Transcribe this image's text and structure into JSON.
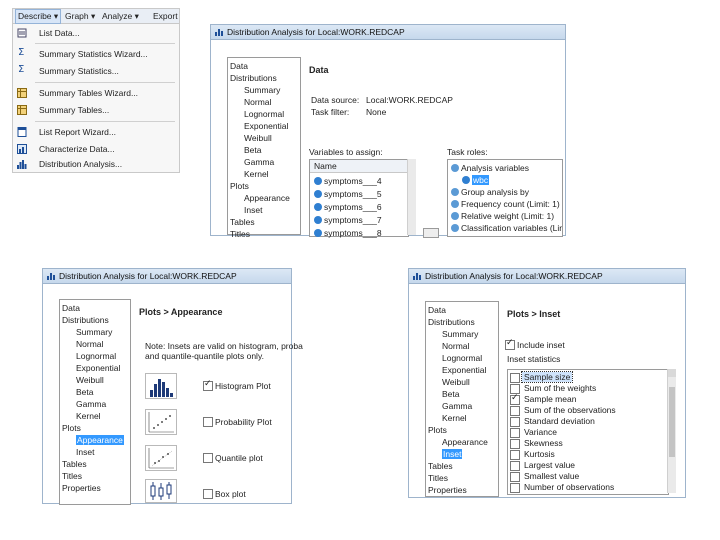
{
  "menu": {
    "bar": [
      "Describe",
      "Graph",
      "Analyze",
      "Export"
    ],
    "items": [
      {
        "label": "List Data...",
        "icon": "list-data-icon"
      },
      {
        "label": "Summary Statistics Wizard...",
        "icon": "sigma-icon"
      },
      {
        "label": "Summary Statistics...",
        "icon": "sigma-icon"
      },
      {
        "label": "Summary Tables Wizard...",
        "icon": "table-icon"
      },
      {
        "label": "Summary Tables...",
        "icon": "table-icon"
      },
      {
        "label": "List Report Wizard...",
        "icon": "report-icon"
      },
      {
        "label": "Characterize Data...",
        "icon": "characterize-icon"
      },
      {
        "label": "Distribution Analysis...",
        "icon": "distribution-icon"
      }
    ]
  },
  "dialog_title": "Distribution Analysis for Local:WORK.REDCAP",
  "nav": {
    "data": "Data",
    "distributions": "Distributions",
    "summary": "Summary",
    "normal": "Normal",
    "lognormal": "Lognormal",
    "exponential": "Exponential",
    "weibull": "Weibull",
    "beta": "Beta",
    "gamma": "Gamma",
    "kernel": "Kernel",
    "plots": "Plots",
    "appearance": "Appearance",
    "inset": "Inset",
    "tables": "Tables",
    "titles": "Titles",
    "properties": "Properties"
  },
  "dialog1": {
    "heading": "Data",
    "data_source_label": "Data source:",
    "data_source_value": "Local:WORK.REDCAP",
    "task_filter_label": "Task filter:",
    "task_filter_value": "None",
    "vars_label": "Variables to assign:",
    "name_header": "Name",
    "variables": [
      "symptoms___4",
      "symptoms___5",
      "symptoms___6",
      "symptoms___7",
      "symptoms___8"
    ],
    "roles_label": "Task roles:",
    "roles": [
      {
        "label": "Analysis variables",
        "icon": "role-icon"
      },
      {
        "label": "wbc",
        "icon": "variable-icon",
        "selected": true
      },
      {
        "label": "Group analysis by",
        "icon": "role-icon"
      },
      {
        "label": "Frequency count  (Limit: 1)",
        "icon": "role-icon"
      },
      {
        "label": "Relative weight  (Limit: 1)",
        "icon": "role-icon"
      },
      {
        "label": "Classification variables  (Lin",
        "icon": "role-icon"
      }
    ]
  },
  "dialog2": {
    "heading": "Plots > Appearance",
    "note": [
      "Note: Insets are valid on histogram, proba",
      "and quantile-quantile plots only."
    ],
    "plots": [
      {
        "label": "Histogram Plot",
        "checked": true
      },
      {
        "label": "Probability Plot",
        "checked": false
      },
      {
        "label": "Quantile plot",
        "checked": false
      },
      {
        "label": "Box plot",
        "checked": false
      }
    ]
  },
  "dialog3": {
    "heading": "Plots > Inset",
    "include_inset": "Include inset",
    "include_checked": true,
    "inset_statistics": "Inset statistics",
    "stats": [
      {
        "label": "Sample size",
        "checked": false,
        "selected": true
      },
      {
        "label": "Sum of the weights",
        "checked": false
      },
      {
        "label": "Sample mean",
        "checked": true
      },
      {
        "label": "Sum of the observations",
        "checked": false
      },
      {
        "label": "Standard deviation",
        "checked": false
      },
      {
        "label": "Variance",
        "checked": false
      },
      {
        "label": "Skewness",
        "checked": false
      },
      {
        "label": "Kurtosis",
        "checked": false
      },
      {
        "label": "Largest value",
        "checked": false
      },
      {
        "label": "Smallest value",
        "checked": false
      },
      {
        "label": "Number of observations",
        "checked": false
      }
    ]
  }
}
